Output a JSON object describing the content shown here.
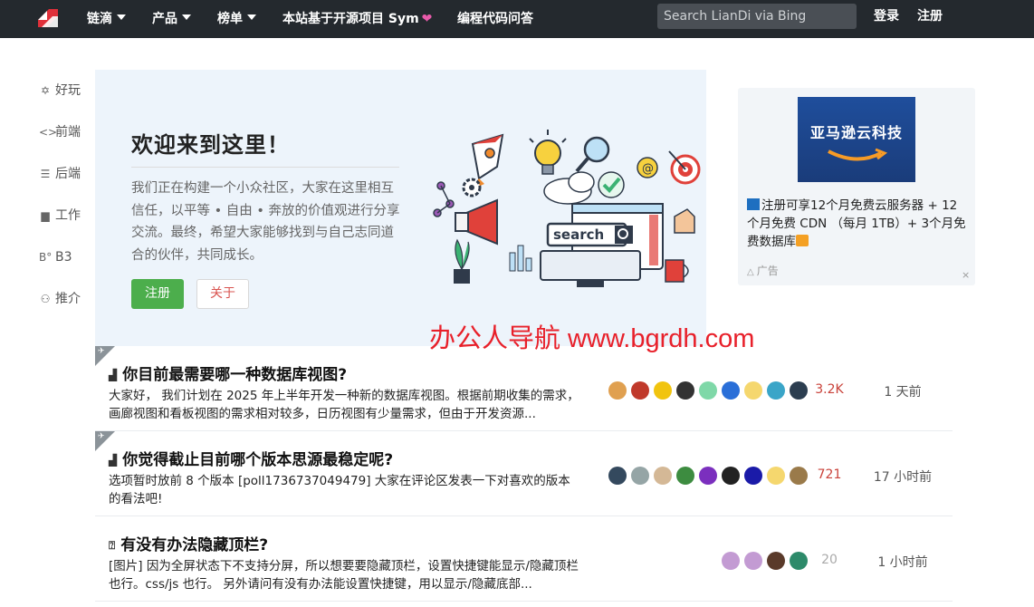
{
  "nav": {
    "items": [
      {
        "label": "链滴",
        "has_caret": true
      },
      {
        "label": "产品",
        "has_caret": true
      },
      {
        "label": "榜单",
        "has_caret": true
      },
      {
        "label": "本站基于开源项目 Sym",
        "has_caret": false,
        "icon": "heart-icon"
      },
      {
        "label": "编程代码问答",
        "has_caret": false
      }
    ],
    "search_placeholder": "Search LianDi via Bing",
    "login": "登录",
    "register": "注册"
  },
  "sidebar": [
    {
      "label": "好玩",
      "icon": "star-icon"
    },
    {
      "label": "前端",
      "icon": "code-icon"
    },
    {
      "label": "后端",
      "icon": "server-icon"
    },
    {
      "label": "工作",
      "icon": "briefcase-icon"
    },
    {
      "label": "B3",
      "icon": "b3-icon"
    },
    {
      "label": "推介",
      "icon": "recommend-icon"
    }
  ],
  "hero": {
    "title": "欢迎来到这里！",
    "text": "我们正在构建一个小众社区，大家在这里相互信任，以平等 • 自由 • 奔放的价值观进行分享交流。最终，希望大家能够找到与自己志同道合的伙伴，共同成长。",
    "register_btn": "注册",
    "about_btn": "关于",
    "art_search_label": "search"
  },
  "ad": {
    "banner_text": "亚马逊云科技",
    "text": "注册可享12个月免费云服务器 + 12个月免费 CDN （每月 1TB）+ 3个月免费数据库",
    "label": "广告",
    "close": "×"
  },
  "watermark": "办公人导航 www.bgrdh.com",
  "posts": [
    {
      "pinned": true,
      "icon": "poll-icon",
      "title": "你目前最需要哪一种数据库视图?",
      "desc": "大家好， 我们计划在 2025 年上半年开发一种新的数据库视图。根据前期收集的需求，画廊视图和看板视图的需求相对较多，日历视图有少量需求，但由于开发资源...",
      "count": "3.2K",
      "count_color": "#c9423a",
      "time": "1 天前",
      "avatars": [
        "#e0a050",
        "#c0392b",
        "#f1c40f",
        "#333333",
        "#7fd8a8",
        "#2a6fd8",
        "#f5d76e",
        "#3aa5c8",
        "#2c3e50"
      ]
    },
    {
      "pinned": true,
      "icon": "poll-icon",
      "title": "你觉得截止目前哪个版本思源最稳定呢?",
      "desc": "选项暂时放前 8 个版本 [poll1736737049479] 大家在评论区发表一下对喜欢的版本的看法吧!",
      "count": "721",
      "count_color": "#c9423a",
      "time": "17 小时前",
      "avatars": [
        "#34495e",
        "#95a5a6",
        "#d4b896",
        "#3d8c40",
        "#7b2fbe",
        "#222222",
        "#1a1aa8",
        "#f5d76e",
        "#9a7a4a"
      ]
    },
    {
      "pinned": false,
      "icon": "question-icon",
      "title": "有没有办法隐藏顶栏?",
      "desc": "[图片] 因为全屏状态下不支持分屏，所以想要要隐藏顶栏，设置快捷键能显示/隐藏顶栏也行。css/js 也行。 另外请问有没有办法能设置快捷键，用以显示/隐藏底部...",
      "count": "20",
      "count_color": "#aaaaaa",
      "time": "1 小时前",
      "avatars": [
        "#c39bd3",
        "#c39bd3",
        "#5a3a2a",
        "#2d8a6a"
      ]
    }
  ]
}
